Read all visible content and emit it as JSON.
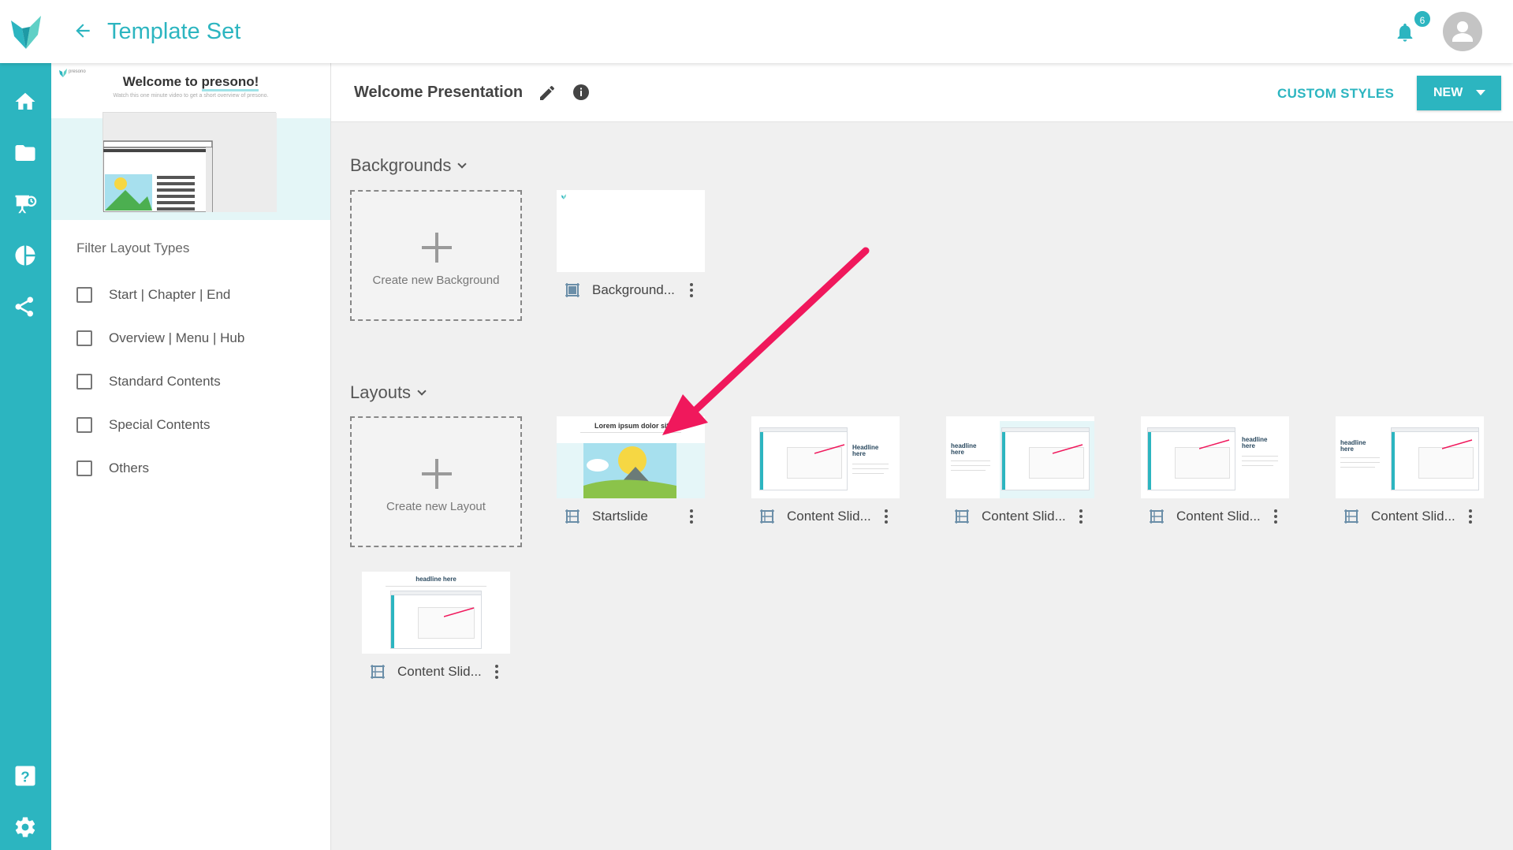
{
  "app": {
    "title": "Template Set",
    "notification_count": "6",
    "brand_color": "#2cb5c0",
    "accent_arrow_color": "#f0185c"
  },
  "leftnav": {
    "icons": [
      "home-icon",
      "folder-icon",
      "presentation-icon",
      "pie-chart-icon",
      "share-icon",
      "help-icon",
      "settings-icon"
    ]
  },
  "sidebar": {
    "preview": {
      "logo_text": "presono",
      "title_prefix": "Welcome to ",
      "title_highlight": "presono!",
      "subtitle": "Watch this one minute video to get a short overview of presono."
    },
    "filter_title": "Filter Layout Types",
    "filters": [
      {
        "label": "Start | Chapter | End",
        "checked": false
      },
      {
        "label": "Overview | Menu | Hub",
        "checked": false
      },
      {
        "label": "Standard Contents",
        "checked": false
      },
      {
        "label": "Special Contents",
        "checked": false
      },
      {
        "label": "Others",
        "checked": false
      }
    ]
  },
  "header": {
    "presentation_title": "Welcome Presentation",
    "custom_styles_label": "CUSTOM STYLES",
    "new_label": "NEW"
  },
  "backgrounds": {
    "title": "Backgrounds",
    "create_label": "Create new Background",
    "items": [
      {
        "label": "Background..."
      }
    ]
  },
  "layouts": {
    "title": "Layouts",
    "create_label": "Create new Layout",
    "items": [
      {
        "label": "Startslide",
        "thumb_text": "Lorem ipsum dolor sit"
      },
      {
        "label": "Content Slid...",
        "thumb_text": "Headline here"
      },
      {
        "label": "Content Slid...",
        "thumb_text": "headline here"
      },
      {
        "label": "Content Slid...",
        "thumb_text": "headline here"
      },
      {
        "label": "Content Slid...",
        "thumb_text": "headline here"
      },
      {
        "label": "Content Slid...",
        "thumb_text": "headline here"
      }
    ]
  }
}
